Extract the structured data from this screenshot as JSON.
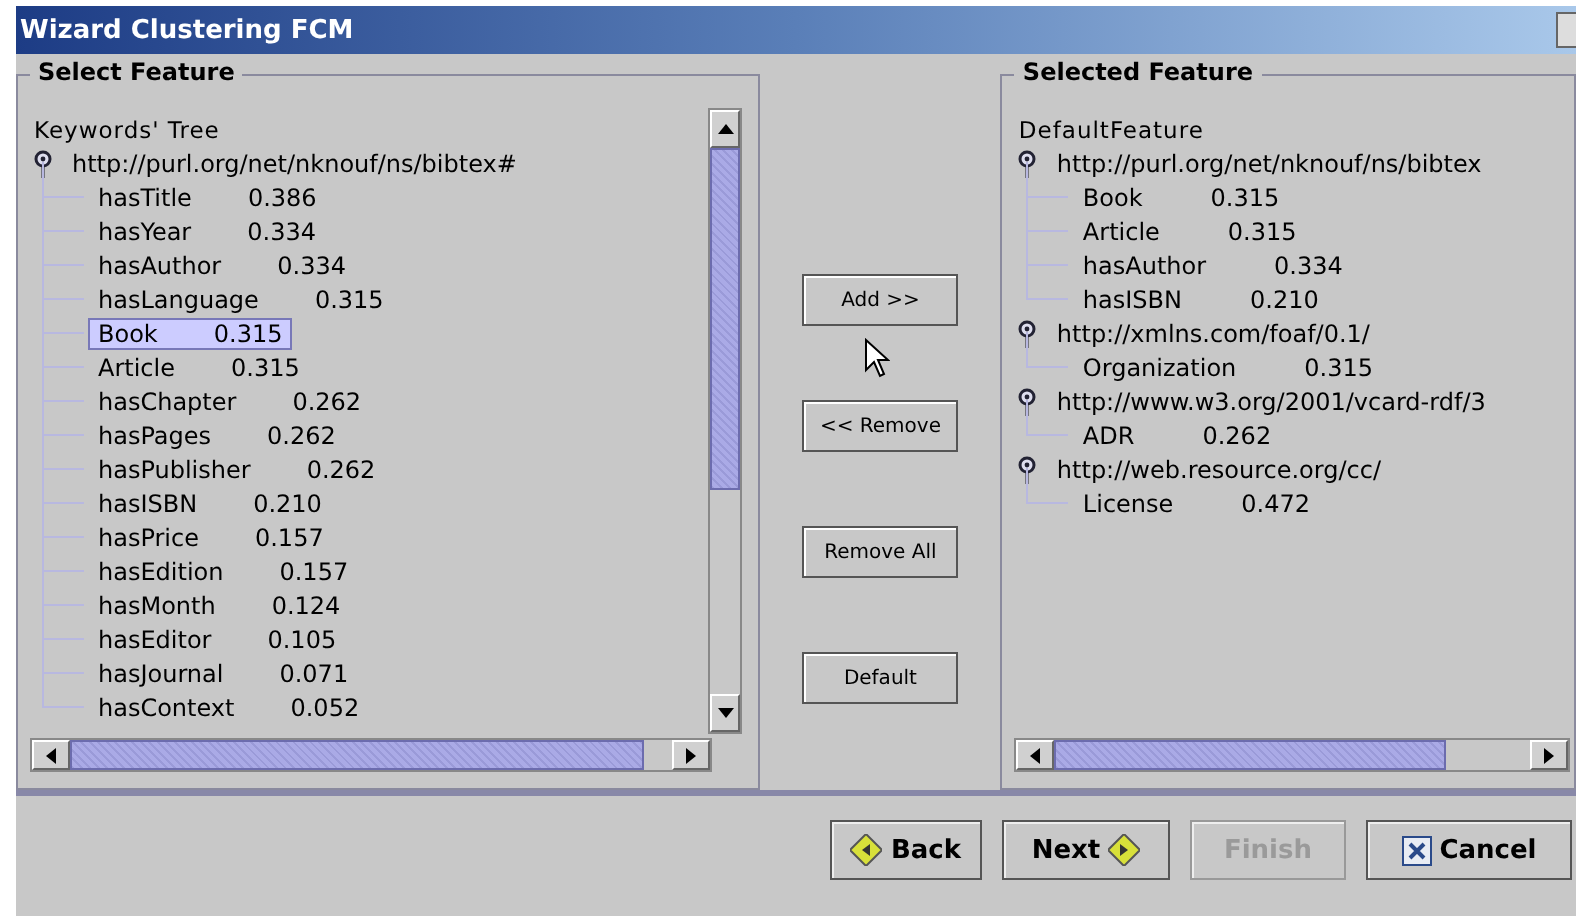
{
  "window": {
    "title": "Wizard Clustering FCM"
  },
  "select_panel": {
    "title": "Select Feature",
    "tree_label": "Keywords' Tree",
    "tree": [
      {
        "label": "http://purl.org/net/nknouf/ns/bibtex#",
        "children": [
          {
            "name": "hasTitle",
            "value": "0.386",
            "selected": false
          },
          {
            "name": "hasYear",
            "value": "0.334",
            "selected": false
          },
          {
            "name": "hasAuthor",
            "value": "0.334",
            "selected": false
          },
          {
            "name": "hasLanguage",
            "value": "0.315",
            "selected": false
          },
          {
            "name": "Book",
            "value": "0.315",
            "selected": true
          },
          {
            "name": "Article",
            "value": "0.315",
            "selected": false
          },
          {
            "name": "hasChapter",
            "value": "0.262",
            "selected": false
          },
          {
            "name": "hasPages",
            "value": "0.262",
            "selected": false
          },
          {
            "name": "hasPublisher",
            "value": "0.262",
            "selected": false
          },
          {
            "name": "hasISBN",
            "value": "0.210",
            "selected": false
          },
          {
            "name": "hasPrice",
            "value": "0.157",
            "selected": false
          },
          {
            "name": "hasEdition",
            "value": "0.157",
            "selected": false
          },
          {
            "name": "hasMonth",
            "value": "0.124",
            "selected": false
          },
          {
            "name": "hasEditor",
            "value": "0.105",
            "selected": false
          },
          {
            "name": "hasJournal",
            "value": "0.071",
            "selected": false
          },
          {
            "name": "hasContext",
            "value": "0.052",
            "selected": false
          }
        ]
      }
    ]
  },
  "actions": [
    "Add >>",
    "<< Remove",
    "Remove All",
    "Default"
  ],
  "selected_panel": {
    "title": "Selected Feature",
    "tree_label": "DefaultFeature",
    "tree": [
      {
        "label": "http://purl.org/net/nknouf/ns/bibtex",
        "children": [
          {
            "name": "Book",
            "value": "0.315"
          },
          {
            "name": "Article",
            "value": "0.315"
          },
          {
            "name": "hasAuthor",
            "value": "0.334"
          },
          {
            "name": "hasISBN",
            "value": "0.210"
          }
        ]
      },
      {
        "label": "http://xmlns.com/foaf/0.1/",
        "children": [
          {
            "name": "Organization",
            "value": "0.315"
          }
        ]
      },
      {
        "label": "http://www.w3.org/2001/vcard-rdf/3",
        "children": [
          {
            "name": "ADR",
            "value": "0.262"
          }
        ]
      },
      {
        "label": "http://web.resource.org/cc/",
        "children": [
          {
            "name": "License",
            "value": "0.472"
          }
        ]
      }
    ]
  },
  "footer_buttons": [
    {
      "label": "Back",
      "kind": "back",
      "disabled": false
    },
    {
      "label": "Next",
      "kind": "next",
      "disabled": false
    },
    {
      "label": "Finish",
      "kind": "plain",
      "disabled": true
    },
    {
      "label": "Cancel",
      "kind": "cancel",
      "disabled": false
    }
  ]
}
